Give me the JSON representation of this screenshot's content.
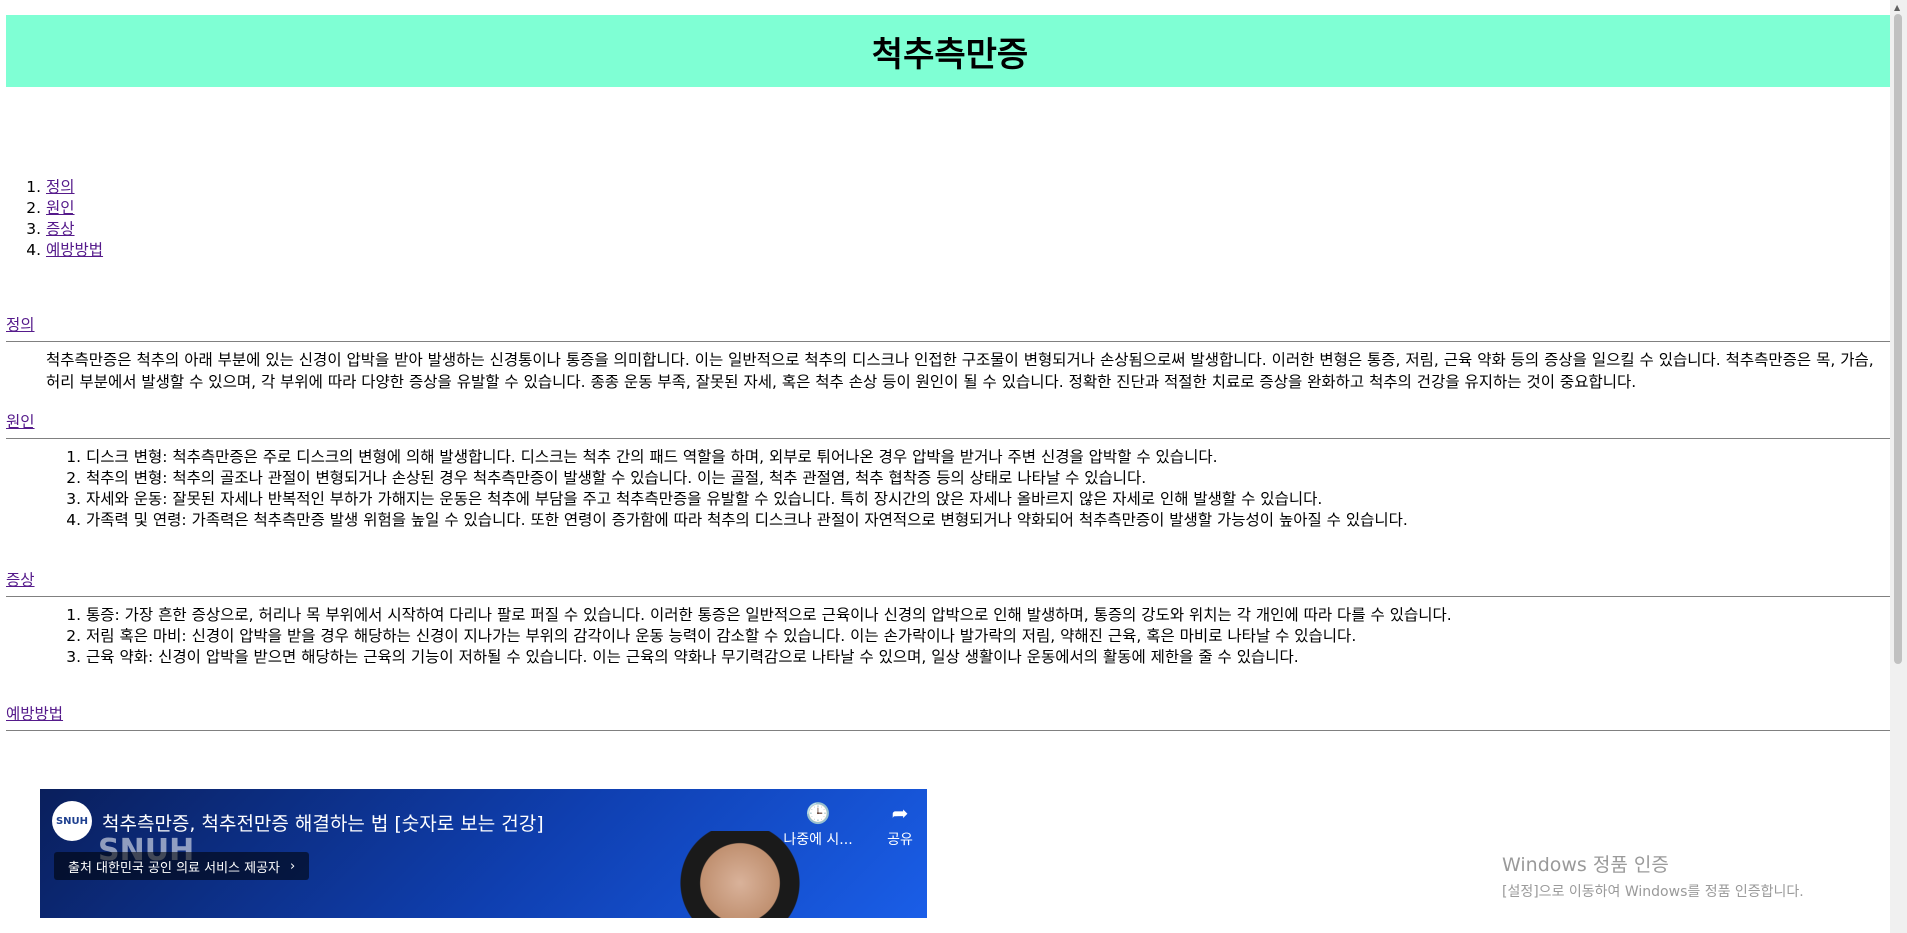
{
  "header": {
    "title": "척추측만증"
  },
  "toc": [
    "정의",
    "원인",
    "증상",
    "예방방법"
  ],
  "sections": {
    "definition": {
      "heading": "정의",
      "text": "척추측만증은 척추의 아래 부분에 있는 신경이 압박을 받아 발생하는 신경통이나 통증을 의미합니다. 이는 일반적으로 척추의 디스크나 인접한 구조물이 변형되거나 손상됨으로써 발생합니다. 이러한 변형은 통증, 저림, 근육 약화 등의 증상을 일으킬 수 있습니다. 척추측만증은 목, 가슴, 허리 부분에서 발생할 수 있으며, 각 부위에 따라 다양한 증상을 유발할 수 있습니다. 종종 운동 부족, 잘못된 자세, 혹은 척추 손상 등이 원인이 될 수 있습니다. 정확한 진단과 적절한 치료로 증상을 완화하고 척추의 건강을 유지하는 것이 중요합니다."
    },
    "causes": {
      "heading": "원인",
      "items": [
        "디스크 변형: 척추측만증은 주로 디스크의 변형에 의해 발생합니다. 디스크는 척추 간의 패드 역할을 하며, 외부로 튀어나온 경우 압박을 받거나 주변 신경을 압박할 수 있습니다.",
        "척추의 변형: 척추의 골조나 관절이 변형되거나 손상된 경우 척추측만증이 발생할 수 있습니다. 이는 골절, 척추 관절염, 척추 협착증 등의 상태로 나타날 수 있습니다.",
        "자세와 운동: 잘못된 자세나 반복적인 부하가 가해지는 운동은 척추에 부담을 주고 척추측만증을 유발할 수 있습니다. 특히 장시간의 앉은 자세나 올바르지 않은 자세로 인해 발생할 수 있습니다.",
        "가족력 및 연령: 가족력은 척추측만증 발생 위험을 높일 수 있습니다. 또한 연령이 증가함에 따라 척추의 디스크나 관절이 자연적으로 변형되거나 약화되어 척추측만증이 발생할 가능성이 높아질 수 있습니다."
      ]
    },
    "symptoms": {
      "heading": "증상",
      "items": [
        "통증: 가장 흔한 증상으로, 허리나 목 부위에서 시작하여 다리나 팔로 퍼질 수 있습니다. 이러한 통증은 일반적으로 근육이나 신경의 압박으로 인해 발생하며, 통증의 강도와 위치는 각 개인에 따라 다를 수 있습니다.",
        "저림 혹은 마비: 신경이 압박을 받을 경우 해당하는 신경이 지나가는 부위의 감각이나 운동 능력이 감소할 수 있습니다. 이는 손가락이나 발가락의 저림, 약해진 근육, 혹은 마비로 나타날 수 있습니다.",
        "근육 약화: 신경이 압박을 받으면 해당하는 근육의 기능이 저하될 수 있습니다. 이는 근육의 약화나 무기력감으로 나타날 수 있으며, 일상 생활이나 운동에서의 활동에 제한을 줄 수 있습니다."
      ]
    },
    "prevention": {
      "heading": "예방방법"
    }
  },
  "video": {
    "title": "척추측만증, 척추전만증 해결하는 법 [숫자로 보는 건강]",
    "channel_logo": "SNUH",
    "brand": "SNUH",
    "source_label": "출처 대한민국 공인 의료 서비스 제공자",
    "watch_later": "나중에 시...",
    "share": "공유"
  },
  "watermark": {
    "line1": "Windows 정품 인증",
    "line2": "[설정]으로 이동하여 Windows를 정품 인증합니다."
  }
}
